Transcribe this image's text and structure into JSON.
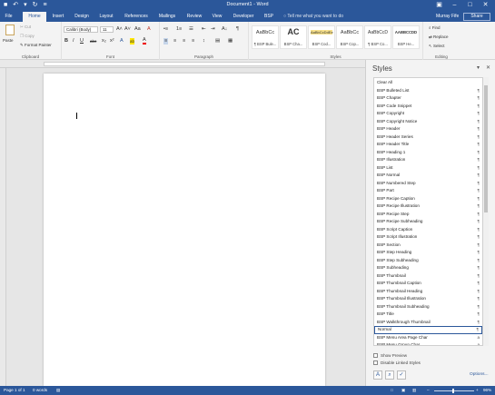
{
  "window": {
    "title": "Document1 - Word"
  },
  "qat": {
    "save_icon": "■",
    "undo_icon": "↶",
    "undo_drop": "▾",
    "redo_icon": "↻",
    "more_icon": "≡"
  },
  "winctl": {
    "options": "▣",
    "minimize": "–",
    "restore": "□",
    "close": "✕"
  },
  "tabs": [
    "File",
    "Home",
    "Insert",
    "Design",
    "Layout",
    "References",
    "Mailings",
    "Review",
    "View",
    "Developer",
    "BSP"
  ],
  "active_tab": "Home",
  "tellme": "Tell me what you want to do",
  "user": "Murray Fife",
  "share": "Share",
  "ribbon": {
    "clipboard": {
      "paste": "Paste",
      "cut": "Cut",
      "copy": "Copy",
      "painter": "Format Painter",
      "label": "Clipboard"
    },
    "font": {
      "name": "Calibri (Body)",
      "size": "11",
      "grow": "A˄",
      "shrink": "A˅",
      "case": "Aa",
      "clear": "A",
      "bold": "B",
      "italic": "I",
      "underline": "U",
      "strike": "abc",
      "sub": "x₂",
      "sup": "x²",
      "effects": "A",
      "highlight": "ab",
      "color": "A",
      "label": "Font"
    },
    "paragraph": {
      "bullets": "•≡",
      "numbering": "1≡",
      "multilevel": "☰",
      "decrease": "⇤",
      "increase": "⇥",
      "sort": "A↓",
      "pilcrow": "¶",
      "align_left": "≡",
      "center": "≡",
      "align_right": "≡",
      "justify": "≡",
      "spacing": "↕",
      "shading": "▤",
      "borders": "▦",
      "label": "Paragraph"
    },
    "styles": {
      "label": "Styles",
      "gallery": [
        {
          "preview": "AaBbCc",
          "name": "¶ BSP Bule..."
        },
        {
          "preview": "AC",
          "name": "BSP Cha..."
        },
        {
          "preview": "AaBbCcDdEe",
          "name": "BSP Cod..."
        },
        {
          "preview": "AaBbCc",
          "name": "BSP Cop..."
        },
        {
          "preview": "AaBbCcD",
          "name": "¶ BSP Co..."
        },
        {
          "preview": "AABBCCDD",
          "name": "BSP He..."
        }
      ]
    },
    "editing": {
      "find": "Find",
      "replace": "Replace",
      "select": "Select",
      "label": "Editing"
    }
  },
  "styles_pane": {
    "title": "Styles",
    "items": [
      {
        "name": "Clear All",
        "mark": ""
      },
      {
        "name": "BSP Bulleted List",
        "mark": "¶"
      },
      {
        "name": "BSP Chapter",
        "mark": "¶"
      },
      {
        "name": "BSP Code Snippet",
        "mark": "¶"
      },
      {
        "name": "BSP Copyright",
        "mark": "¶"
      },
      {
        "name": "BSP Copyright Notice",
        "mark": "¶"
      },
      {
        "name": "BSP Header",
        "mark": "¶"
      },
      {
        "name": "BSP Header Series",
        "mark": "¶"
      },
      {
        "name": "BSP Header Title",
        "mark": "¶"
      },
      {
        "name": "BSP Heading 1",
        "mark": "¶"
      },
      {
        "name": "BSP Illustration",
        "mark": "¶"
      },
      {
        "name": "BSP List",
        "mark": "¶"
      },
      {
        "name": "BSP Normal",
        "mark": "¶"
      },
      {
        "name": "BSP Numbered Step",
        "mark": "¶"
      },
      {
        "name": "BSP Part",
        "mark": "¶"
      },
      {
        "name": "BSP Recipe Caption",
        "mark": "¶"
      },
      {
        "name": "BSP Recipe Illustration",
        "mark": "¶"
      },
      {
        "name": "BSP Recipe Step",
        "mark": "¶"
      },
      {
        "name": "BSP Recipe Subheading",
        "mark": "¶"
      },
      {
        "name": "BSP Script Caption",
        "mark": "¶"
      },
      {
        "name": "BSP Script Illustration",
        "mark": "¶"
      },
      {
        "name": "BSP Section",
        "mark": "¶"
      },
      {
        "name": "BSP Step Heading",
        "mark": "¶"
      },
      {
        "name": "BSP Step Subheading",
        "mark": "¶"
      },
      {
        "name": "BSP Subheading",
        "mark": "¶"
      },
      {
        "name": "BSP Thumbnail",
        "mark": "¶"
      },
      {
        "name": "BSP Thumbnail Caption",
        "mark": "¶"
      },
      {
        "name": "BSP Thumbnail Heading",
        "mark": "¶"
      },
      {
        "name": "BSP Thumbnail Illustration",
        "mark": "¶"
      },
      {
        "name": "BSP Thumbnail Subheading",
        "mark": "¶"
      },
      {
        "name": "BSP Title",
        "mark": "¶"
      },
      {
        "name": "BSP Walkthrough Thumbnail",
        "mark": "¶"
      },
      {
        "name": "Normal",
        "mark": "¶"
      },
      {
        "name": "BSP Menu Area Page Char",
        "mark": "a"
      },
      {
        "name": "BSP Menu Group Char",
        "mark": "a"
      }
    ],
    "selected": "Normal",
    "show_preview": "Show Preview",
    "disable_linked": "Disable Linked Styles",
    "options": "Options..."
  },
  "status": {
    "page": "Page 1 of 1",
    "words": "0 words",
    "zoom": "96%"
  },
  "zoom_level": 0.96,
  "colors": {
    "accent": "#2b579a",
    "ribbon_bg": "#f3f3f3"
  }
}
